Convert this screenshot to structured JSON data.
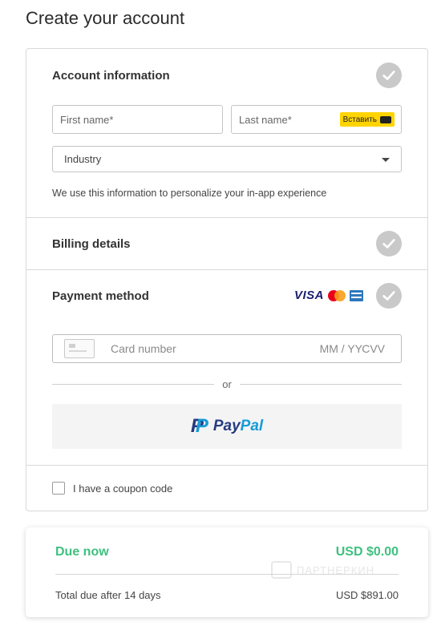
{
  "page": {
    "title": "Create your account"
  },
  "account": {
    "title": "Account information",
    "first_name_placeholder": "First name*",
    "last_name_placeholder": "Last name*",
    "paste_button": "Вставить",
    "industry_selected": "Industry",
    "help_text": "We use this information to personalize your in-app experience"
  },
  "billing": {
    "title": "Billing details"
  },
  "payment": {
    "title": "Payment method",
    "brands": [
      "VISA",
      "Mastercard",
      "American Express"
    ],
    "visa_label": "VISA",
    "card_number_placeholder": "Card number",
    "expiry_placeholder": "MM / YY",
    "cvv_placeholder": "CVV",
    "or_text": "or",
    "paypal_label_1": "Pay",
    "paypal_label_2": "Pal"
  },
  "coupon": {
    "label": "I have a coupon code"
  },
  "summary": {
    "due_now_label": "Due now",
    "due_now_amount": "USD $0.00",
    "total_label": "Total due after 14 days",
    "total_amount": "USD $891.00",
    "watermark": "ПАРТНЕРКИН"
  },
  "colors": {
    "accent_green": "#3fc07f",
    "check_gray": "#c9c9c9",
    "paste_yellow": "#ffd400",
    "paypal_dark": "#253b80",
    "paypal_light": "#179bd7"
  }
}
